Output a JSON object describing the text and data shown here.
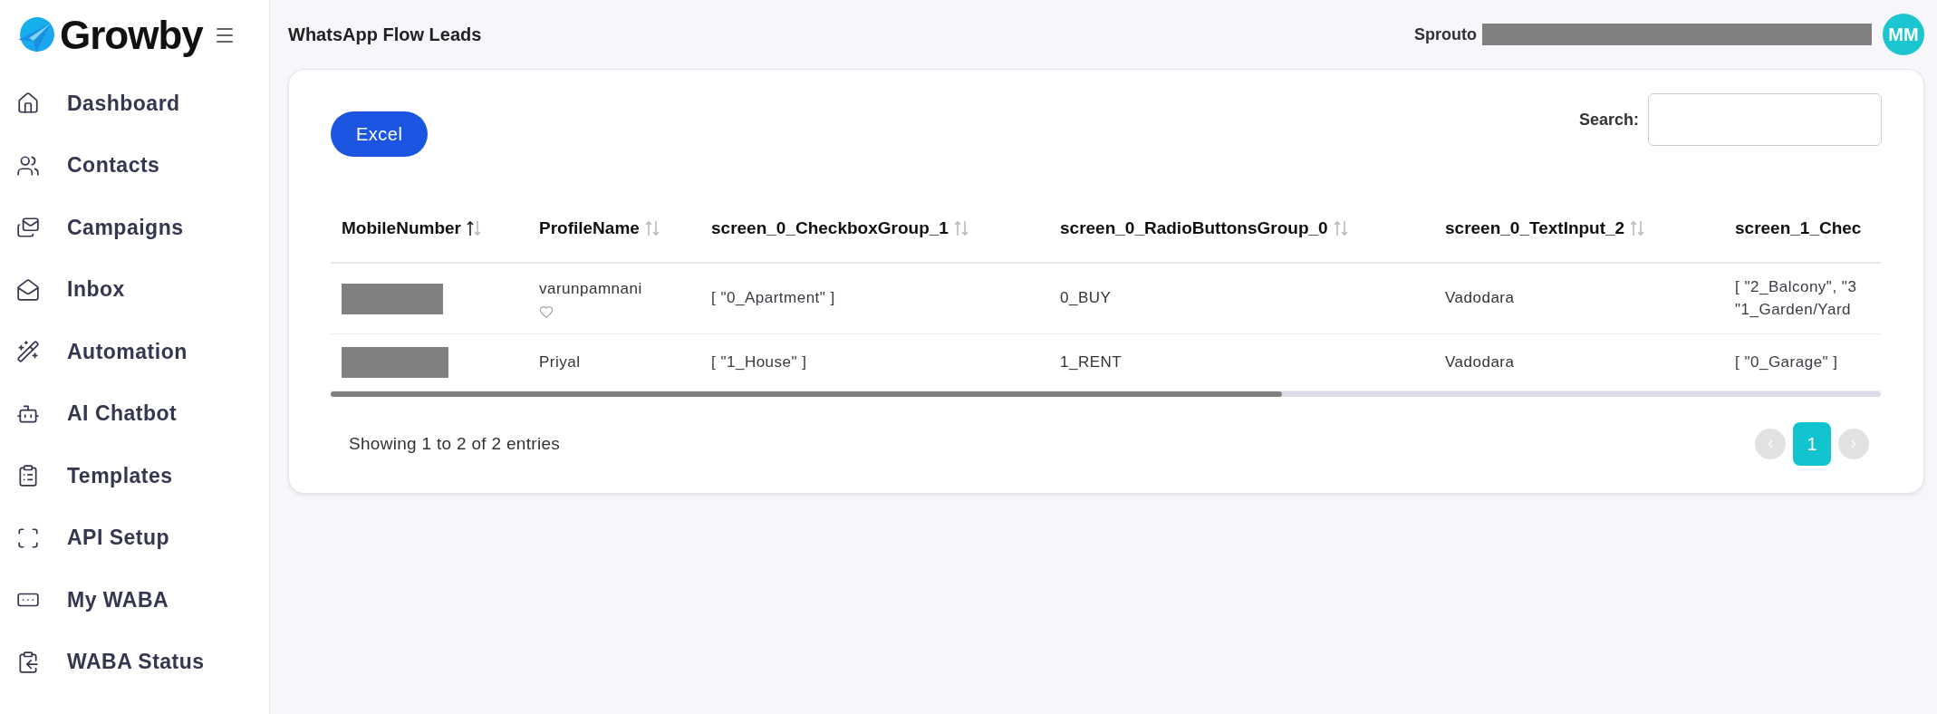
{
  "sidebar": {
    "brand": "Growby",
    "items": [
      {
        "label": "Dashboard"
      },
      {
        "label": "Contacts"
      },
      {
        "label": "Campaigns"
      },
      {
        "label": "Inbox"
      },
      {
        "label": "Automation"
      },
      {
        "label": "AI Chatbot"
      },
      {
        "label": "Templates"
      },
      {
        "label": "API Setup"
      },
      {
        "label": "My WABA"
      },
      {
        "label": "WABA Status"
      }
    ]
  },
  "header": {
    "title": "WhatsApp Flow Leads",
    "user_name": "Sprouto",
    "avatar_initials": "MM"
  },
  "toolbar": {
    "export_button": "Excel",
    "search_label": "Search:"
  },
  "table": {
    "columns": [
      {
        "label": "MobileNumber",
        "sorted_ascending": true
      },
      {
        "label": "ProfileName",
        "sorted_ascending": false
      },
      {
        "label": "screen_0_CheckboxGroup_1",
        "sorted_ascending": false
      },
      {
        "label": "screen_0_RadioButtonsGroup_0",
        "sorted_ascending": false
      },
      {
        "label": "screen_0_TextInput_2",
        "sorted_ascending": false
      },
      {
        "label": "screen_1_Chec"
      }
    ],
    "rows": [
      {
        "cells": [
          {
            "kind": "redacted"
          },
          {
            "kind": "profile",
            "lines": [
              "varunpamnani"
            ],
            "favorite": false
          },
          {
            "kind": "list",
            "lines": [
              "[ \"0_Apartment\" ]"
            ]
          },
          {
            "kind": "text",
            "lines": [
              "0_BUY"
            ]
          },
          {
            "kind": "text",
            "lines": [
              "Vadodara"
            ]
          },
          {
            "kind": "list",
            "lines": [
              "[ \"2_Balcony\", \"3",
              "\"1_Garden/Yard"
            ]
          }
        ]
      },
      {
        "cells": [
          {
            "kind": "redacted"
          },
          {
            "kind": "profile",
            "lines": [
              "Priyal"
            ]
          },
          {
            "kind": "list",
            "lines": [
              "[ \"1_House\" ]"
            ]
          },
          {
            "kind": "text",
            "lines": [
              "1_RENT"
            ]
          },
          {
            "kind": "text",
            "lines": [
              "Vadodara"
            ]
          },
          {
            "kind": "list",
            "lines": [
              "[ \"0_Garage\" ]"
            ]
          }
        ]
      }
    ]
  },
  "footer": {
    "info": "Showing 1 to 2 of 2 entries",
    "prev_disabled": true,
    "next_disabled": true,
    "pages": [
      {
        "label": "1",
        "selected": true
      }
    ]
  }
}
